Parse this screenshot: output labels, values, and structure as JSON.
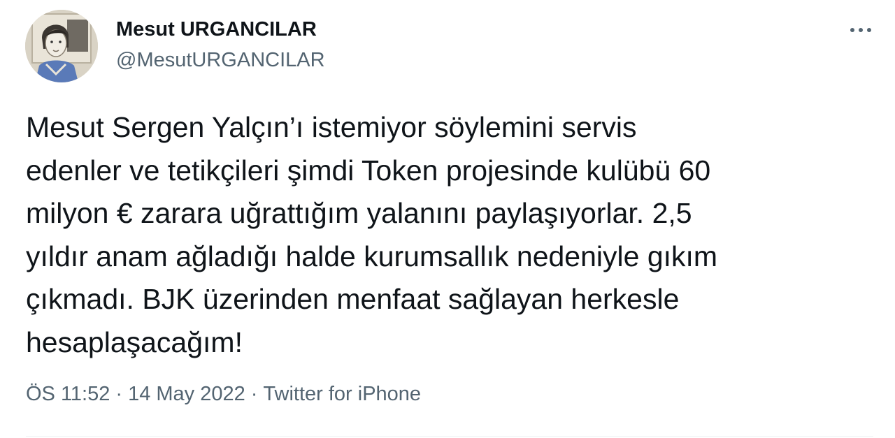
{
  "tweet": {
    "author": {
      "display_name": "Mesut URGANCILAR",
      "handle": "@MesutURGANCILAR"
    },
    "text": "Mesut Sergen Yalçın’ı istemiyor söylemini servis\nedenler ve tetikçileri şimdi Token projesinde kulübü 60\nmilyon € zarara uğrattığım yalanını paylaşıyorlar. 2,5\nyıldır anam ağladığı halde kurumsallık nedeniyle gıkım\nçıkmadı. BJK üzerinden menfaat sağlayan herkesle\nhesaplaşacağım!",
    "time": "ÖS 11:52",
    "date": "14 May 2022",
    "source": "Twitter for iPhone",
    "separator": "·",
    "more_icon": "more-horizontal-icon"
  },
  "colors": {
    "text_primary": "#0f1419",
    "text_secondary": "#536471",
    "divider": "#eff3f4"
  }
}
